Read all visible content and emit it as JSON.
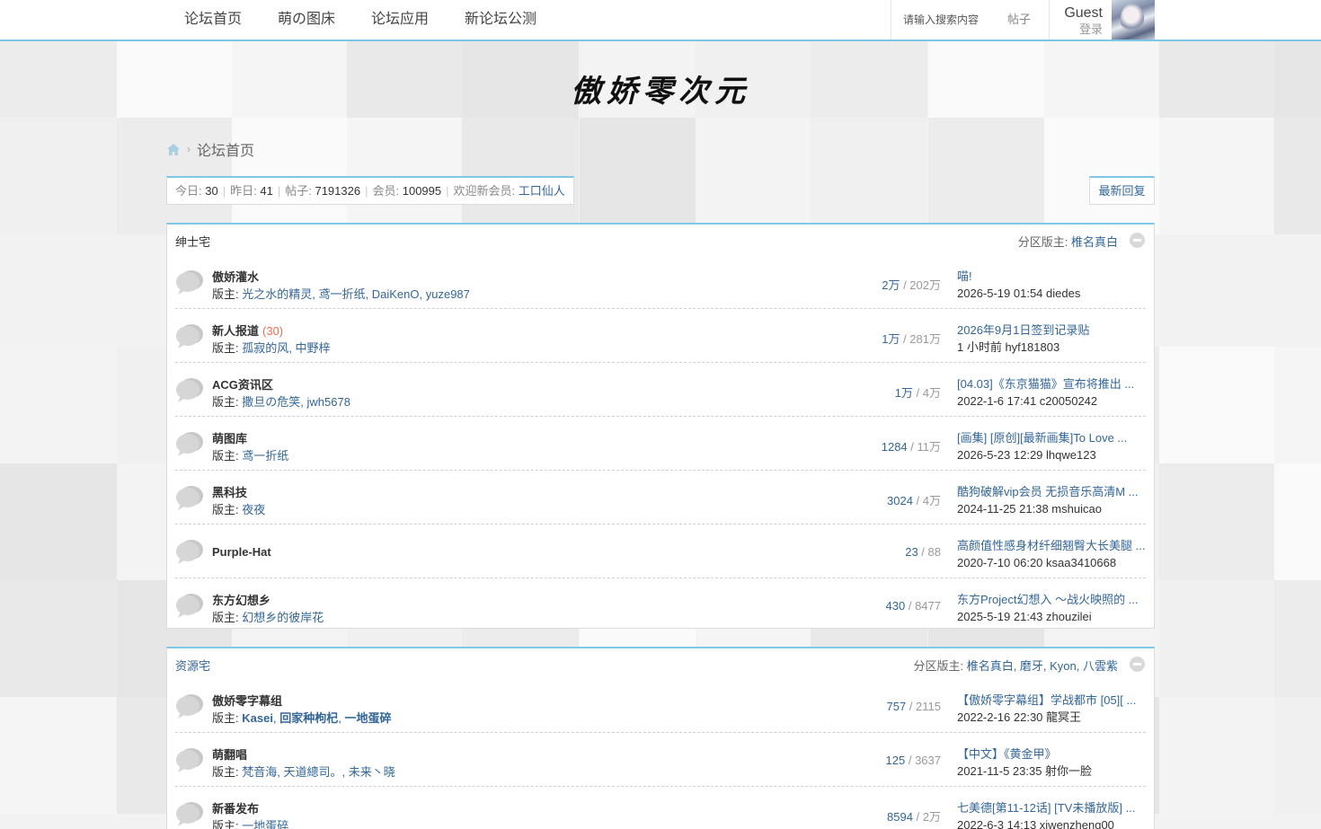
{
  "nav": {
    "items": [
      "论坛首页",
      "萌の图床",
      "论坛应用",
      "新论坛公测"
    ]
  },
  "search": {
    "placeholder": "请输入搜索内容",
    "type": "帖子"
  },
  "user": {
    "name": "Guest",
    "login": "登录"
  },
  "logo": {
    "text": "傲娇零次元"
  },
  "breadcrumb": {
    "current": "论坛首页"
  },
  "stats": {
    "today_label": "今日:",
    "today": "30",
    "yesterday_label": "昨日:",
    "yesterday": "41",
    "posts_label": "帖子:",
    "posts": "7191326",
    "members_label": "会员:",
    "members": "100995",
    "newest_label": "欢迎新会员:",
    "newest_member": "工口仙人"
  },
  "latest_replies_label": "最新回复",
  "mod_prefix": "版主:",
  "sections": [
    {
      "title": "绅士宅",
      "mod_label": "分区版主:",
      "mods": "椎名真白",
      "forums": [
        {
          "name": "傲娇灌水",
          "today": "",
          "mods": [
            {
              "n": "光之水的精灵"
            },
            {
              "n": "鸢一折纸"
            },
            {
              "n": "DaiKenO"
            },
            {
              "n": "yuze987"
            }
          ],
          "threads": "2万",
          "posts": "202万",
          "last_title": "喵!",
          "last_meta": "2026-5-19 01:54 diedes"
        },
        {
          "name": "新人报道",
          "today": "(30)",
          "mods": [
            {
              "n": "孤寂的风"
            },
            {
              "n": "中野梓"
            }
          ],
          "threads": "1万",
          "posts": "281万",
          "last_title": "2026年9月1日签到记录贴",
          "last_meta": "1 小时前 hyf181803"
        },
        {
          "name": "ACG资讯区",
          "today": "",
          "mods": [
            {
              "n": "撒旦の危笑"
            },
            {
              "n": "jwh5678"
            }
          ],
          "threads": "1万",
          "posts": "4万",
          "last_title": "[04.03]《东京猫猫》宣布将推出 ...",
          "last_meta": "2022-1-6 17:41 c20050242"
        },
        {
          "name": "萌图库",
          "today": "",
          "mods": [
            {
              "n": "鸢一折纸"
            }
          ],
          "threads": "1284",
          "posts": "11万",
          "last_title": "[画集] [原创][最新画集]To Love ...",
          "last_meta": "2026-5-23 12:29 lhqwe123"
        },
        {
          "name": "黑科技",
          "today": "",
          "mods": [
            {
              "n": "夜夜"
            }
          ],
          "threads": "3024",
          "posts": "4万",
          "last_title": "酷狗破解vip会员 无损音乐高清M ...",
          "last_meta": "2024-11-25 21:38 mshuicao"
        },
        {
          "name": "Purple-Hat",
          "today": "",
          "mods": [],
          "threads": "23",
          "posts": "88",
          "last_title": "高颜值性感身材纤细翘臀大长美腿 ...",
          "last_meta": "2020-7-10 06:20 ksaa3410668"
        },
        {
          "name": "东方幻想乡",
          "today": "",
          "mods": [
            {
              "n": "幻想乡的彼岸花"
            }
          ],
          "threads": "430",
          "posts": "8477",
          "last_title": "东方Project幻想入 ～战火映照的 ...",
          "last_meta": "2025-5-19 21:43 zhouzilei"
        }
      ]
    },
    {
      "title": "资源宅",
      "mod_label": "分区版主:",
      "mods": "椎名真白, 磨牙, Kyon, 八雲紫",
      "forums": [
        {
          "name": "傲娇零字幕组",
          "today": "",
          "mods": [
            {
              "n": "Kasei",
              "b": true
            },
            {
              "n": "回家种枸杞",
              "b": true
            },
            {
              "n": "一地蛋碎",
              "b": true
            }
          ],
          "threads": "757",
          "posts": "2115",
          "last_title": "【傲娇零字幕组】学战都市 [05][ ...",
          "last_meta": "2022-2-16 22:30 龍冥王"
        },
        {
          "name": "萌翻唱",
          "today": "",
          "mods": [
            {
              "n": "梵音海"
            },
            {
              "n": "天道總司。"
            },
            {
              "n": "未来丶晓"
            }
          ],
          "threads": "125",
          "posts": "3637",
          "last_title": "【中文】《黄金甲》",
          "last_meta": "2021-11-5 23:35 射你一脸"
        },
        {
          "name": "新番发布",
          "today": "",
          "mods": [
            {
              "n": "一地蛋碎"
            }
          ],
          "threads": "8594",
          "posts": "2万",
          "last_title": "七美德[第11-12话] [TV未播放版] ...",
          "last_meta": "2022-6-3 14:13 xiwenzheng00"
        }
      ]
    }
  ]
}
